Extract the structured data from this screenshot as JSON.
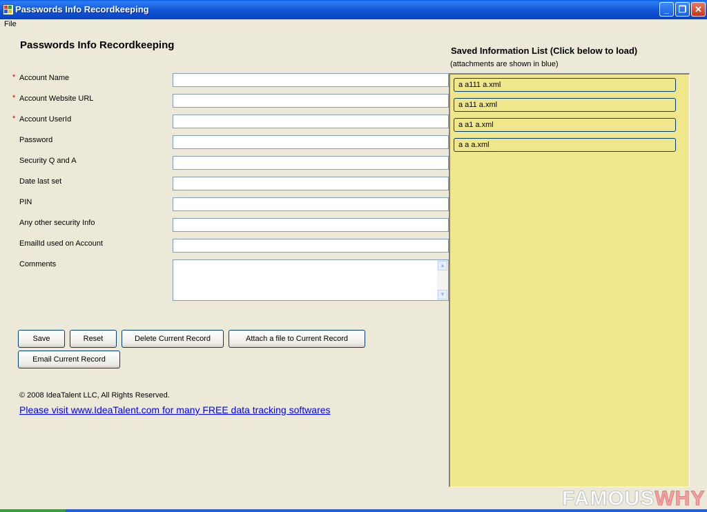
{
  "window": {
    "title": "Passwords Info Recordkeeping",
    "minimize_glyph": "_",
    "maximize_glyph": "❐",
    "close_glyph": "✕"
  },
  "menu": {
    "file_label": "File"
  },
  "form": {
    "title": "Passwords Info Recordkeeping",
    "required_marker": "*",
    "fields": [
      {
        "label": "Account Name",
        "value": ""
      },
      {
        "label": "Account Website URL",
        "value": ""
      },
      {
        "label": "Account UserId",
        "value": ""
      },
      {
        "label": "Password",
        "value": ""
      },
      {
        "label": "Security Q and A",
        "value": ""
      },
      {
        "label": "Date last set",
        "value": ""
      },
      {
        "label": "PIN",
        "value": ""
      },
      {
        "label": "Any other security Info",
        "value": ""
      },
      {
        "label": "EmailId used on Account",
        "value": ""
      }
    ],
    "comments_label": "Comments",
    "comments_value": ""
  },
  "buttons": {
    "save": "Save",
    "reset": "Reset",
    "delete": "Delete Current Record",
    "attach": "Attach a file to Current Record",
    "email": "Email Current Record"
  },
  "footer": {
    "copyright": "© 2008 IdeaTalent LLC, All Rights Reserved.",
    "link": "Please visit www.IdeaTalent.com for many FREE data tracking softwares"
  },
  "saved_list": {
    "title": "Saved Information List (Click below to load)",
    "subtitle": "(attachments are shown in blue)",
    "items": [
      "a a111 a.xml",
      "a a11 a.xml",
      "a a1 a.xml",
      "a a a.xml"
    ]
  },
  "watermark": {
    "part1": "FAMOUS",
    "part2": "WHY"
  },
  "colors": {
    "list_background": "#f0e68c",
    "link": "#0000ff",
    "required": "#cc0000",
    "title_bar": "#0a47c6"
  }
}
